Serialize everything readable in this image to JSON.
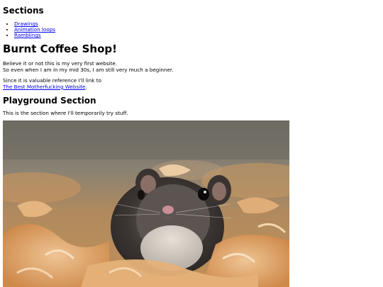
{
  "sections": {
    "title": "Sections",
    "links": [
      "Drawings",
      "Animation loops",
      "Ramblings"
    ]
  },
  "header": {
    "title": "Burnt Coffee Shop!"
  },
  "intro": {
    "line1": "Believe it or not this is my very first website.",
    "line2": "So even when I am in my mid 30s, I am still very much a beginner."
  },
  "reference": {
    "text": "Since it is valuable reference I'll link to",
    "link_text": "The Best Motherfucking Website",
    "suffix": "."
  },
  "playground": {
    "title": "Playground Section",
    "description": "This is the section where I'll temporarily try stuff."
  },
  "image": {
    "subject": "hamster in wood shavings"
  }
}
